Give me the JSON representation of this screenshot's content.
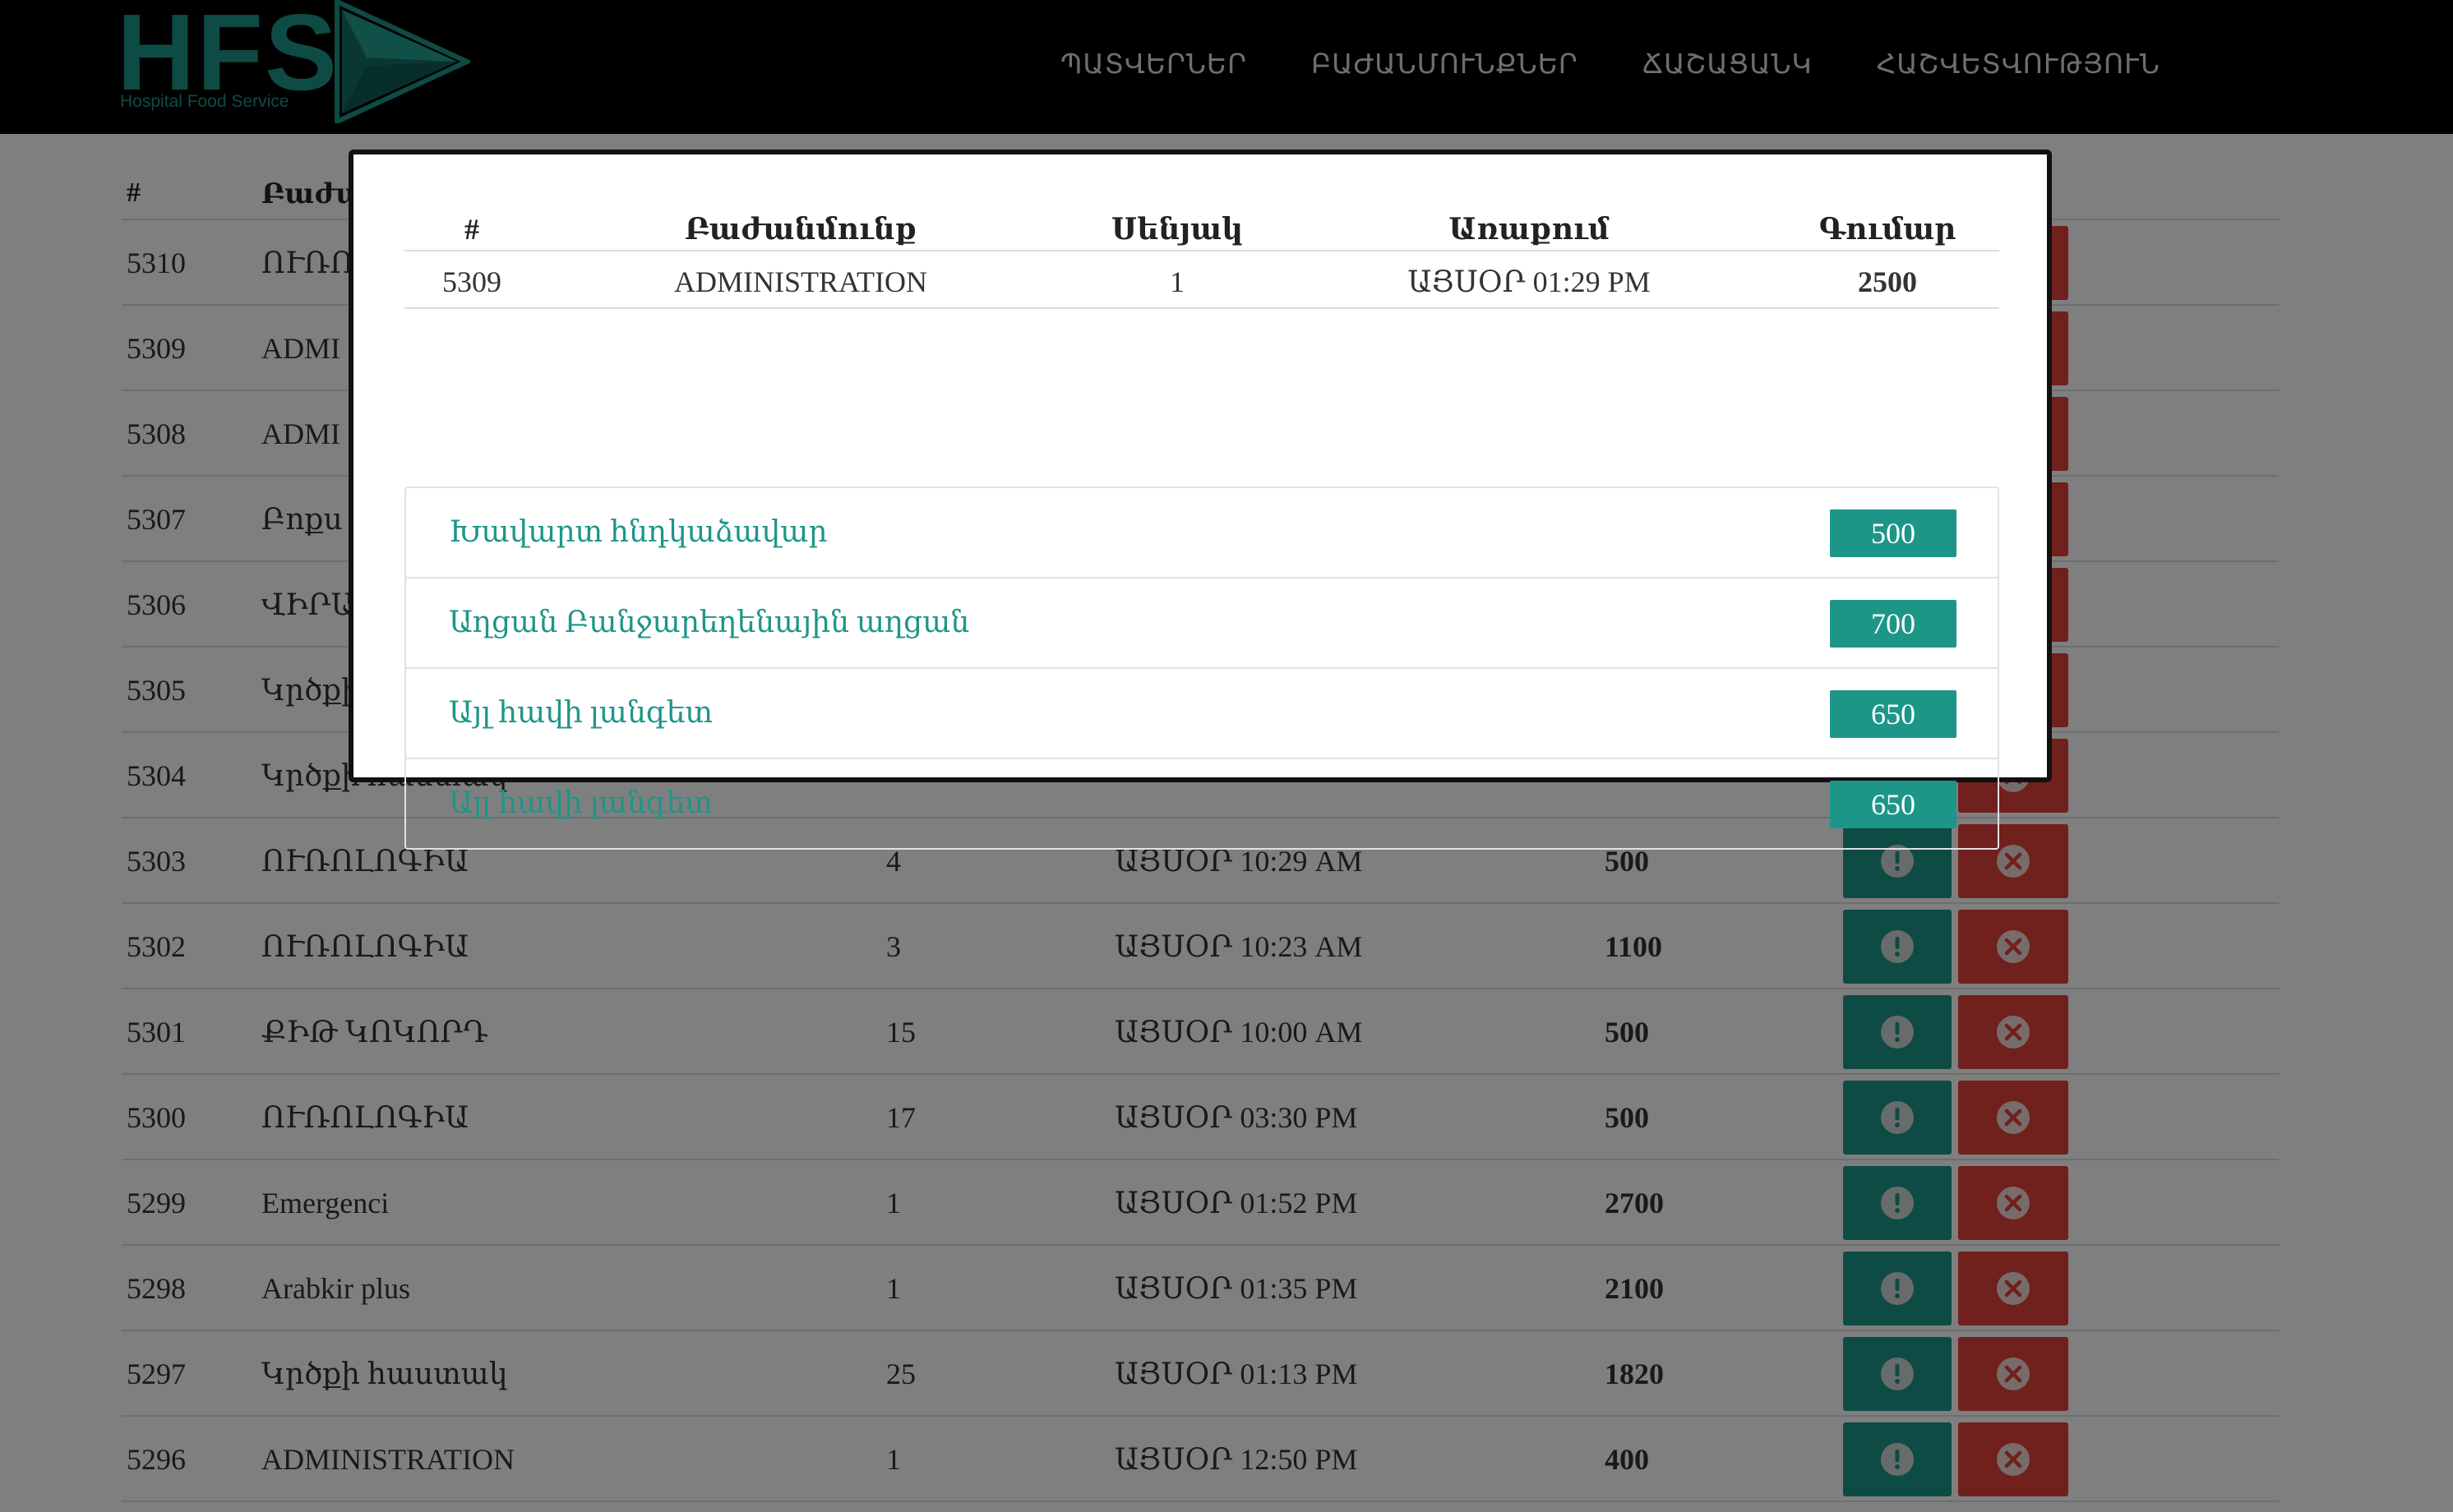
{
  "brand": {
    "name": "HFS",
    "subtitle": "Hospital Food Service",
    "color": "#1d9688"
  },
  "nav": {
    "items": [
      "ՊԱՏՎԵՐՆԵՐ",
      "ԲԱԺԱՆՄՈՒՆՔՆԵՐ",
      "ՃԱՇԱՑԱՆԿ",
      "ՀԱՇՎԵՏՎՈՒԹՅՈՒՆ"
    ]
  },
  "orders_table": {
    "headers": [
      "#",
      "Բաժա"
    ],
    "rows": [
      {
        "id": "5310",
        "department": "ՈՒՌՈ",
        "qty": "",
        "time": "",
        "sum": ""
      },
      {
        "id": "5309",
        "department": "ADMI",
        "qty": "",
        "time": "",
        "sum": ""
      },
      {
        "id": "5308",
        "department": "ADMI",
        "qty": "",
        "time": "",
        "sum": ""
      },
      {
        "id": "5307",
        "department": "Բոքս",
        "qty": "",
        "time": "",
        "sum": ""
      },
      {
        "id": "5306",
        "department": "ՎԻՐԱ",
        "qty": "",
        "time": "",
        "sum": ""
      },
      {
        "id": "5305",
        "department": "Կրծքի",
        "qty": "",
        "time": "",
        "sum": ""
      },
      {
        "id": "5304",
        "department": "Կրծքի հաստակ",
        "qty": "",
        "time": "",
        "sum": ""
      },
      {
        "id": "5303",
        "department": "ՈՒՌՈԼՈԳԻԱ",
        "qty": "4",
        "time": "ԱՅՍՕՐ 10:29 AM",
        "sum": "500"
      },
      {
        "id": "5302",
        "department": "ՈՒՌՈԼՈԳԻԱ",
        "qty": "3",
        "time": "ԱՅՍՕՐ 10:23 AM",
        "sum": "1100"
      },
      {
        "id": "5301",
        "department": "ՔԻԹ ԿՈԿՈՐԴ",
        "qty": "15",
        "time": "ԱՅՍՕՐ 10:00 AM",
        "sum": "500"
      },
      {
        "id": "5300",
        "department": "ՈՒՌՈԼՈԳԻԱ",
        "qty": "17",
        "time": "ԱՅՍՕՐ 03:30 PM",
        "sum": "500"
      },
      {
        "id": "5299",
        "department": "Emergenci",
        "qty": "1",
        "time": "ԱՅՍՕՐ 01:52 PM",
        "sum": "2700"
      },
      {
        "id": "5298",
        "department": "Arabkir plus",
        "qty": "1",
        "time": "ԱՅՍՕՐ 01:35 PM",
        "sum": "2100"
      },
      {
        "id": "5297",
        "department": "Կրծքի հաստակ",
        "qty": "25",
        "time": "ԱՅՍՕՐ 01:13 PM",
        "sum": "1820"
      },
      {
        "id": "5296",
        "department": "ADMINISTRATION",
        "qty": "1",
        "time": "ԱՅՍՕՐ 12:50 PM",
        "sum": "400"
      }
    ]
  },
  "modal": {
    "headers": {
      "id": "#",
      "department": "Բաժանմունք",
      "room": "Սենյակ",
      "delivery": "Առաքում",
      "sum": "Գումար"
    },
    "order": {
      "id": "5309",
      "department": "ADMINISTRATION",
      "room": "1",
      "delivery": "ԱՅՍՕՐ 01:29 PM",
      "sum": "2500"
    },
    "items": [
      {
        "name": "Խավարտ հնդկաձավար",
        "price": "500"
      },
      {
        "name": "Աղցան Բանջարեղենային աղցան",
        "price": "700"
      },
      {
        "name": "Այլ հավի լանգետ",
        "price": "650"
      },
      {
        "name": "Այլ հավի լանգետ",
        "price": "650"
      }
    ]
  }
}
